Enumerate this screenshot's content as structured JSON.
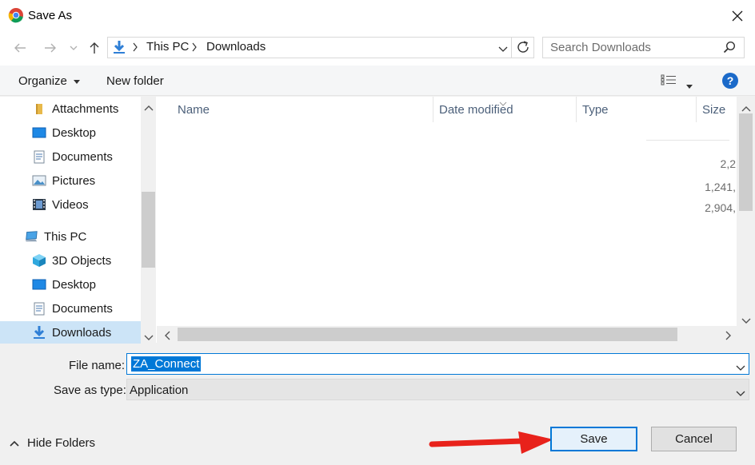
{
  "window": {
    "title": "Save As"
  },
  "address": {
    "segments": [
      "This PC",
      "Downloads"
    ]
  },
  "search": {
    "placeholder": "Search Downloads"
  },
  "toolbar": {
    "organize_label": "Organize",
    "new_folder_label": "New folder",
    "help_label": "?"
  },
  "nav": {
    "items": [
      {
        "label": "Attachments",
        "icon": "folder-icon"
      },
      {
        "label": "Desktop",
        "icon": "desktop-icon"
      },
      {
        "label": "Documents",
        "icon": "documents-icon"
      },
      {
        "label": "Pictures",
        "icon": "pictures-icon"
      },
      {
        "label": "Videos",
        "icon": "videos-icon"
      },
      {
        "label": "This PC",
        "icon": "computer-icon"
      },
      {
        "label": "3D Objects",
        "icon": "3d-objects-icon"
      },
      {
        "label": "Desktop",
        "icon": "desktop-icon"
      },
      {
        "label": "Documents",
        "icon": "documents-icon"
      },
      {
        "label": "Downloads",
        "icon": "downloads-icon"
      }
    ]
  },
  "files": {
    "columns": [
      "Name",
      "Date modified",
      "Type",
      "Size"
    ],
    "sizes": [
      "2,2",
      "1,241,",
      "2,904,"
    ]
  },
  "form": {
    "file_name_label": "File name:",
    "file_name_value": "ZA_Connect",
    "save_type_label": "Save as type:",
    "save_type_value": "Application"
  },
  "footer": {
    "hide_folders_label": "Hide Folders",
    "save_label": "Save",
    "cancel_label": "Cancel"
  },
  "colors": {
    "accent": "#0078d7",
    "arrow": "#e8221b",
    "selected": "#cce4f7"
  }
}
